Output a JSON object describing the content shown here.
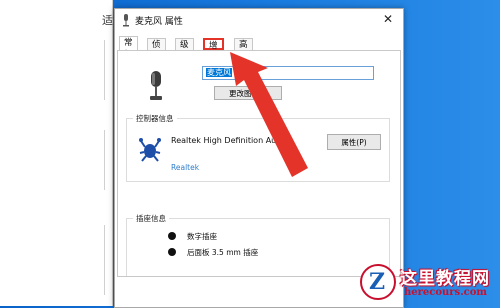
{
  "background_window": {
    "fragment": "适"
  },
  "dialog": {
    "title": "麦克风 属性",
    "close_symbol": "✕",
    "tabs": [
      {
        "label": "常规",
        "active": true
      },
      {
        "label": "侦听",
        "active": false
      },
      {
        "label": "级别",
        "active": false
      },
      {
        "label": "增强",
        "active": false,
        "highlighted": true
      },
      {
        "label": "高级",
        "active": false
      }
    ],
    "device_name_value": "麦克风",
    "change_icon_label": "更改图标(I)",
    "controller": {
      "group_label": "控制器信息",
      "name": "Realtek High Definition Audio",
      "vendor": "Realtek",
      "properties_label": "属性(P)"
    },
    "jack": {
      "group_label": "插座信息",
      "items": [
        "数字插座",
        "后面板 3.5 mm 插座"
      ]
    }
  },
  "annotation": {
    "arrow_color": "#e4342a"
  },
  "watermark": {
    "title": "这里教程网",
    "url": "herecours.com",
    "logo_letter": "Z"
  }
}
